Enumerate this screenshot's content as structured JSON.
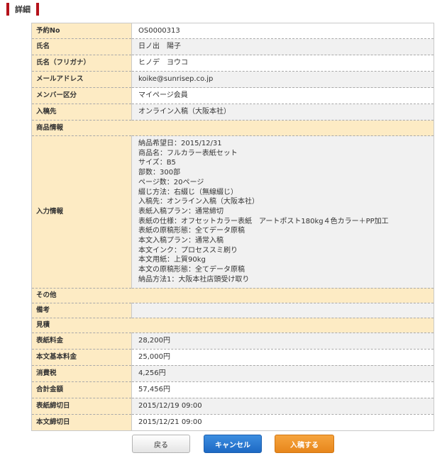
{
  "heading": "詳細",
  "rows": [
    {
      "label": "予約No",
      "value": "OS0000313"
    },
    {
      "label": "氏名",
      "value": "日ノ出　陽子"
    },
    {
      "label": "氏名（フリガナ）",
      "value": "ヒノデ　ヨウコ"
    },
    {
      "label": "メールアドレス",
      "value": "koike@sunrisep.co.jp"
    },
    {
      "label": "メンバー区分",
      "value": "マイページ会員"
    },
    {
      "label": "入稿先",
      "value": "オンライン入稿（大阪本社）"
    }
  ],
  "section_product": "商品情報",
  "input_info": {
    "label": "入力情報",
    "lines": [
      "納品希望日：2015/12/31",
      "商品名：フルカラー表紙セット",
      "サイズ：B5",
      "部数：300部",
      "ページ数：20ページ",
      "綴じ方法：右綴じ（無線綴じ）",
      "入稿先：オンライン入稿（大阪本社）",
      "表紙入稿プラン：通常締切",
      "表紙の仕様：オフセットカラー表紙　アートポスト180kg４色カラー＋PP加工",
      "表紙の原稿形態：全てデータ原稿",
      "本文入稿プラン：通常入稿",
      "本文インク：プロセススミ刷り",
      "本文用紙：上質90kg",
      "本文の原稿形態：全てデータ原稿",
      "納品方法1：大阪本社店頭受け取り"
    ]
  },
  "section_other": "その他",
  "remarks": {
    "label": "備考",
    "value": ""
  },
  "section_estimate": "見積",
  "estimate": [
    {
      "label": "表紙料金",
      "value": "28,200円"
    },
    {
      "label": "本文基本料金",
      "value": "25,000円"
    },
    {
      "label": "消費税",
      "value": "4,256円"
    },
    {
      "label": "合計金額",
      "value": "57,456円"
    },
    {
      "label": "表紙締切日",
      "value": "2015/12/19 09:00"
    },
    {
      "label": "本文締切日",
      "value": "2015/12/21 09:00"
    }
  ],
  "buttons": {
    "back": "戻る",
    "cancel": "キャンセル",
    "submit": "入稿する"
  },
  "colors": {
    "header_bar": "#b5121b",
    "label_bg": "#fdebc4",
    "cancel": "#1d69c4",
    "submit": "#e7861c"
  }
}
